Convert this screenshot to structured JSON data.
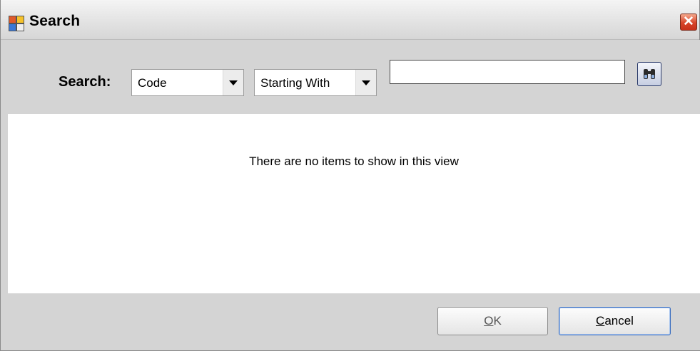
{
  "window": {
    "title": "Search",
    "close_glyph": "✕"
  },
  "search": {
    "label": "Search:",
    "field_value": "Code",
    "operator_value": "Starting With",
    "text_value": "",
    "find_icon": "binoculars-icon"
  },
  "list": {
    "empty_message": "There are no items to show in this view"
  },
  "buttons": {
    "ok_mnemonic": "O",
    "ok_rest": "K",
    "cancel_mnemonic": "C",
    "cancel_rest": "ancel"
  }
}
